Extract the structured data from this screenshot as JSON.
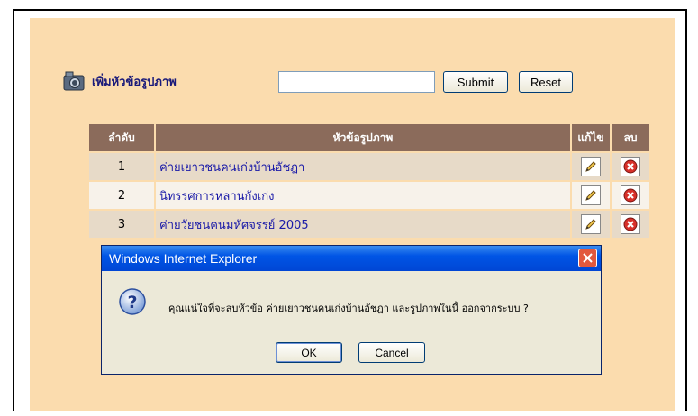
{
  "form": {
    "title": "เพิ่มหัวข้อรูปภาพ",
    "input_value": "",
    "submit_label": "Submit",
    "reset_label": "Reset",
    "camera_icon": "camera-icon"
  },
  "table": {
    "headers": [
      "ลำดับ",
      "หัวข้อรูปภาพ",
      "แก้ไข",
      "ลบ"
    ],
    "rows": [
      {
        "num": "1",
        "topic": "ค่ายเยาวชนคนเก่งบ้านอัชฎา"
      },
      {
        "num": "2",
        "topic": "นิทรรศการหลานกังเก่ง"
      },
      {
        "num": "3",
        "topic": "ค่ายวัยชนคนมหัศจรรย์ 2005"
      }
    ],
    "edit_icon": "pencil-icon",
    "delete_icon": "delete-icon"
  },
  "dialog": {
    "title": "Windows Internet Explorer",
    "message": "คุณแน่ใจที่จะลบหัวข้อ  ค่ายเยาวชนคนเก่งบ้านอัชฎา  และรูปภาพในนี้ ออกจากระบบ ?",
    "ok_label": "OK",
    "cancel_label": "Cancel",
    "icon": "question-icon"
  },
  "colors": {
    "panel_bg": "#fbdcae",
    "header_bg": "#8b6b5b",
    "link": "#1a1aa8",
    "dialog_titlebar": "#0055e5"
  }
}
